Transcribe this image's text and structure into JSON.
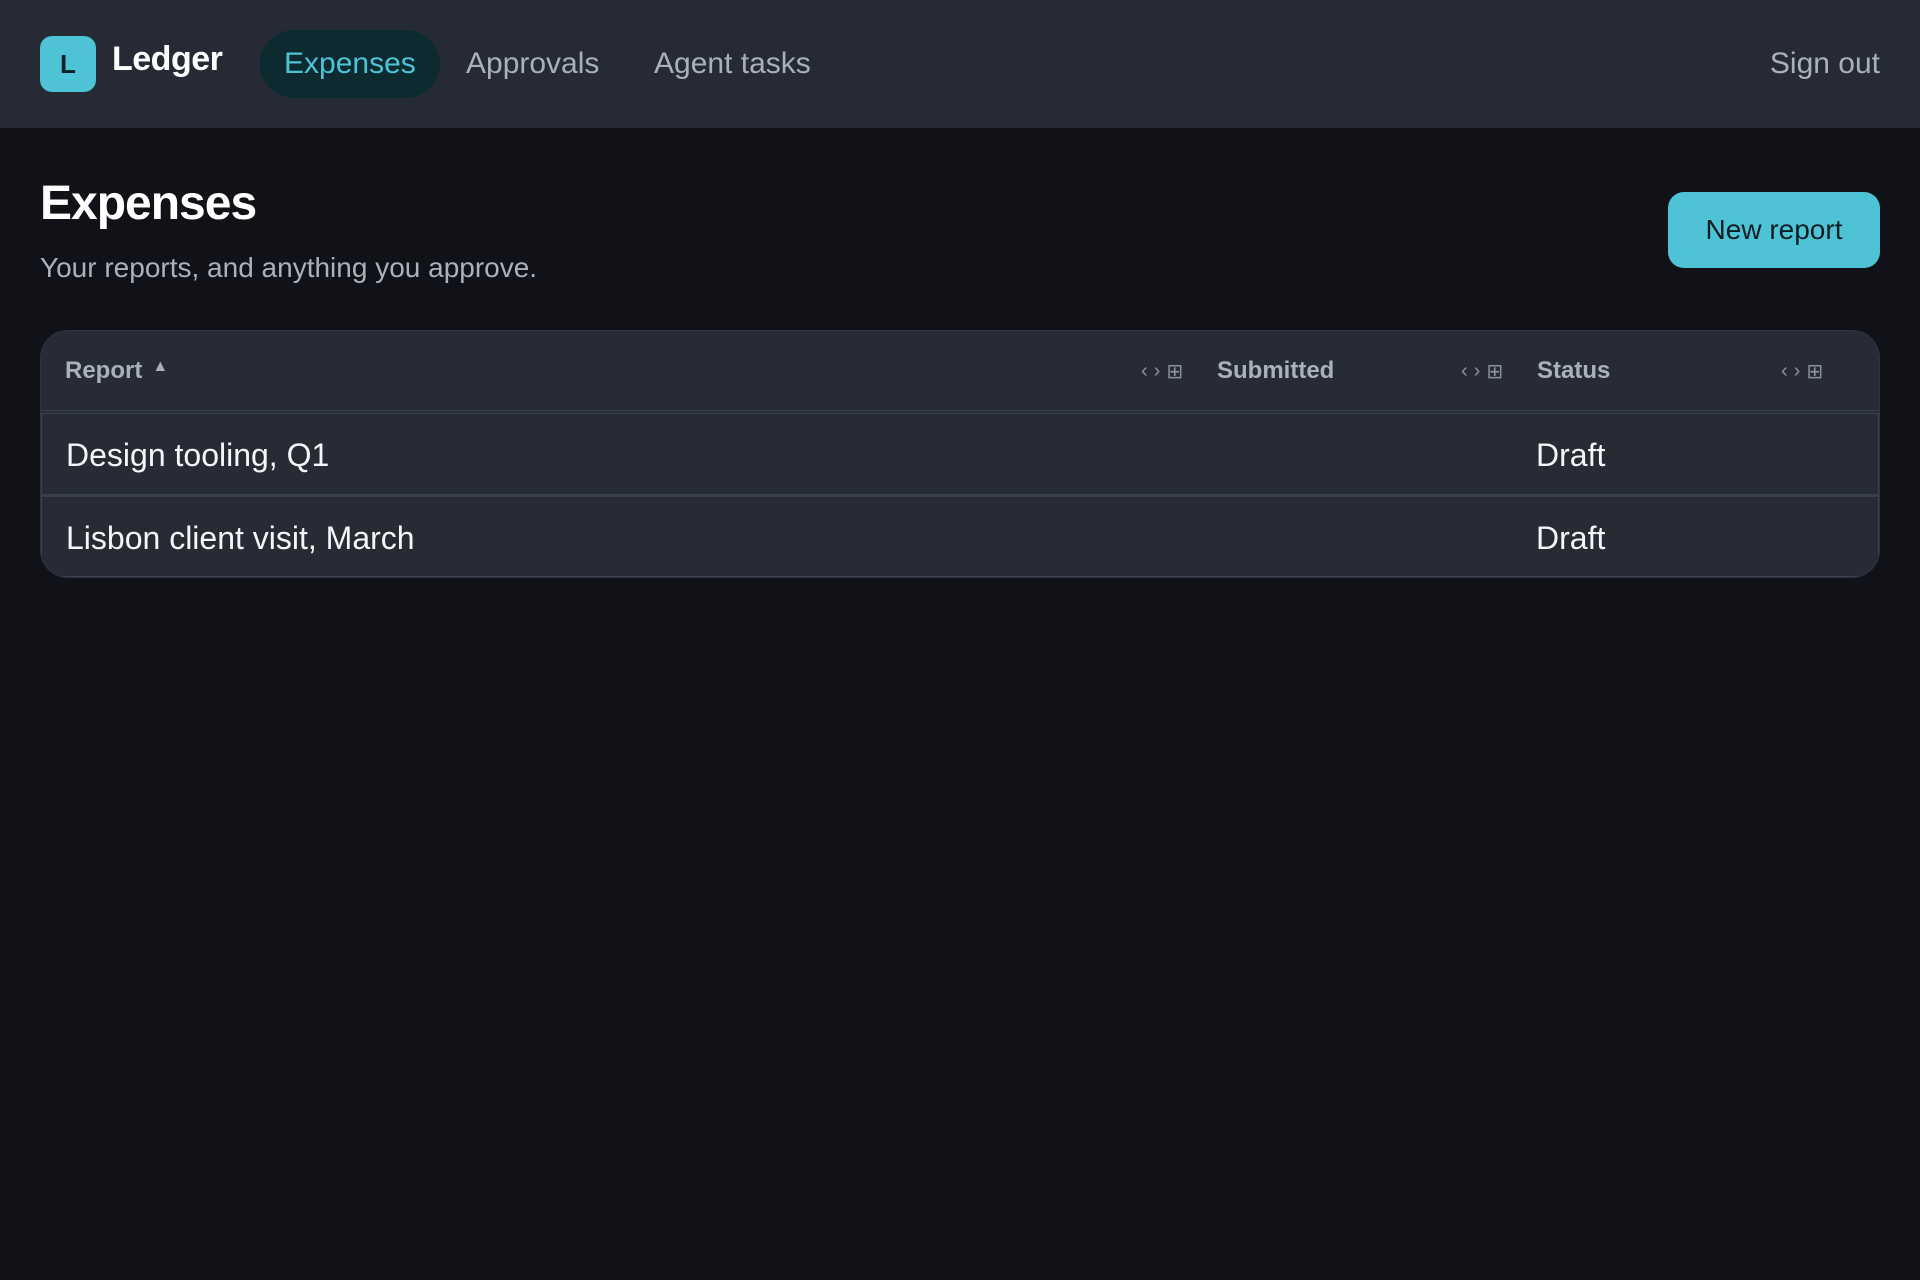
{
  "app": {
    "logo_letter": "L",
    "brand": "Ledger"
  },
  "nav": {
    "items": [
      {
        "label": "Expenses",
        "active": true
      },
      {
        "label": "Approvals",
        "active": false
      },
      {
        "label": "Agent tasks",
        "active": false
      }
    ],
    "sign_out": "Sign out"
  },
  "header": {
    "title": "Expenses",
    "subtitle": "Your reports, and anything you approve.",
    "new_report_label": "New report"
  },
  "table": {
    "columns": [
      {
        "label": "Report",
        "sort": "ascending"
      },
      {
        "label": "Submitted"
      },
      {
        "label": "Status"
      }
    ],
    "column_tool_icons": [
      "chevron-left-icon",
      "chevron-right-icon",
      "grid-icon"
    ],
    "rows": [
      {
        "report": "Design tooling, Q1",
        "submitted": "",
        "status": "Draft"
      },
      {
        "report": "Lisbon client visit, March",
        "submitted": "",
        "status": "Draft"
      }
    ]
  },
  "colors": {
    "accent": "#4fc3d6",
    "background": "#101217",
    "surface": "#272b35",
    "topbar": "#262a35"
  }
}
